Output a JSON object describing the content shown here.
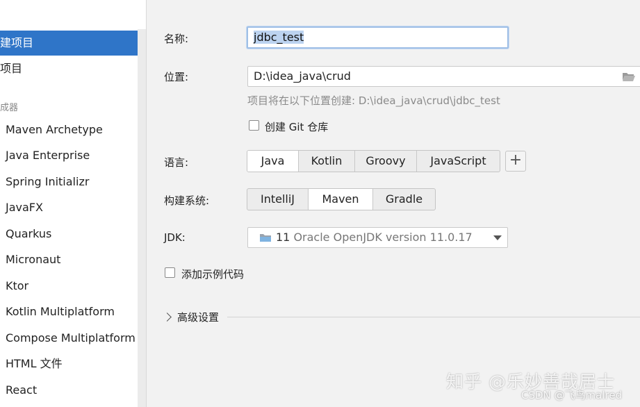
{
  "sidebar": {
    "new_project": "新建项目",
    "empty_project": "空项目",
    "generators_heading": "生成器",
    "generators": [
      "Maven Archetype",
      "Java Enterprise",
      "Spring Initializr",
      "JavaFX",
      "Quarkus",
      "Micronaut",
      "Ktor",
      "Kotlin Multiplatform",
      "Compose Multiplatform",
      "HTML 文件",
      "React"
    ]
  },
  "form": {
    "name_label": "名称:",
    "name_value": "jdbc_test",
    "location_label": "位置:",
    "location_value": "D:\\idea_java\\crud",
    "location_hint": "项目将在以下位置创建: D:\\idea_java\\crud\\jdbc_test",
    "git_label": "创建 Git 仓库",
    "git_checked": false,
    "language_label": "语言:",
    "languages": [
      "Java",
      "Kotlin",
      "Groovy",
      "JavaScript"
    ],
    "language_selected": "Java",
    "add_language": "+",
    "build_label": "构建系统:",
    "build_systems": [
      "IntelliJ",
      "Maven",
      "Gradle"
    ],
    "build_selected": "Maven",
    "jdk_label": "JDK:",
    "jdk_version": "11",
    "jdk_name": "Oracle OpenJDK version 11.0.17",
    "sample_code_label": "添加示例代码",
    "sample_code_checked": false,
    "advanced_label": "高级设置"
  },
  "watermark": {
    "zhihu": "知乎 @乐妙善哉居士",
    "csdn": "CSDN @飞鸟malred"
  },
  "colors": {
    "accent": "#2f75c8",
    "selection": "#bcd3f0"
  }
}
